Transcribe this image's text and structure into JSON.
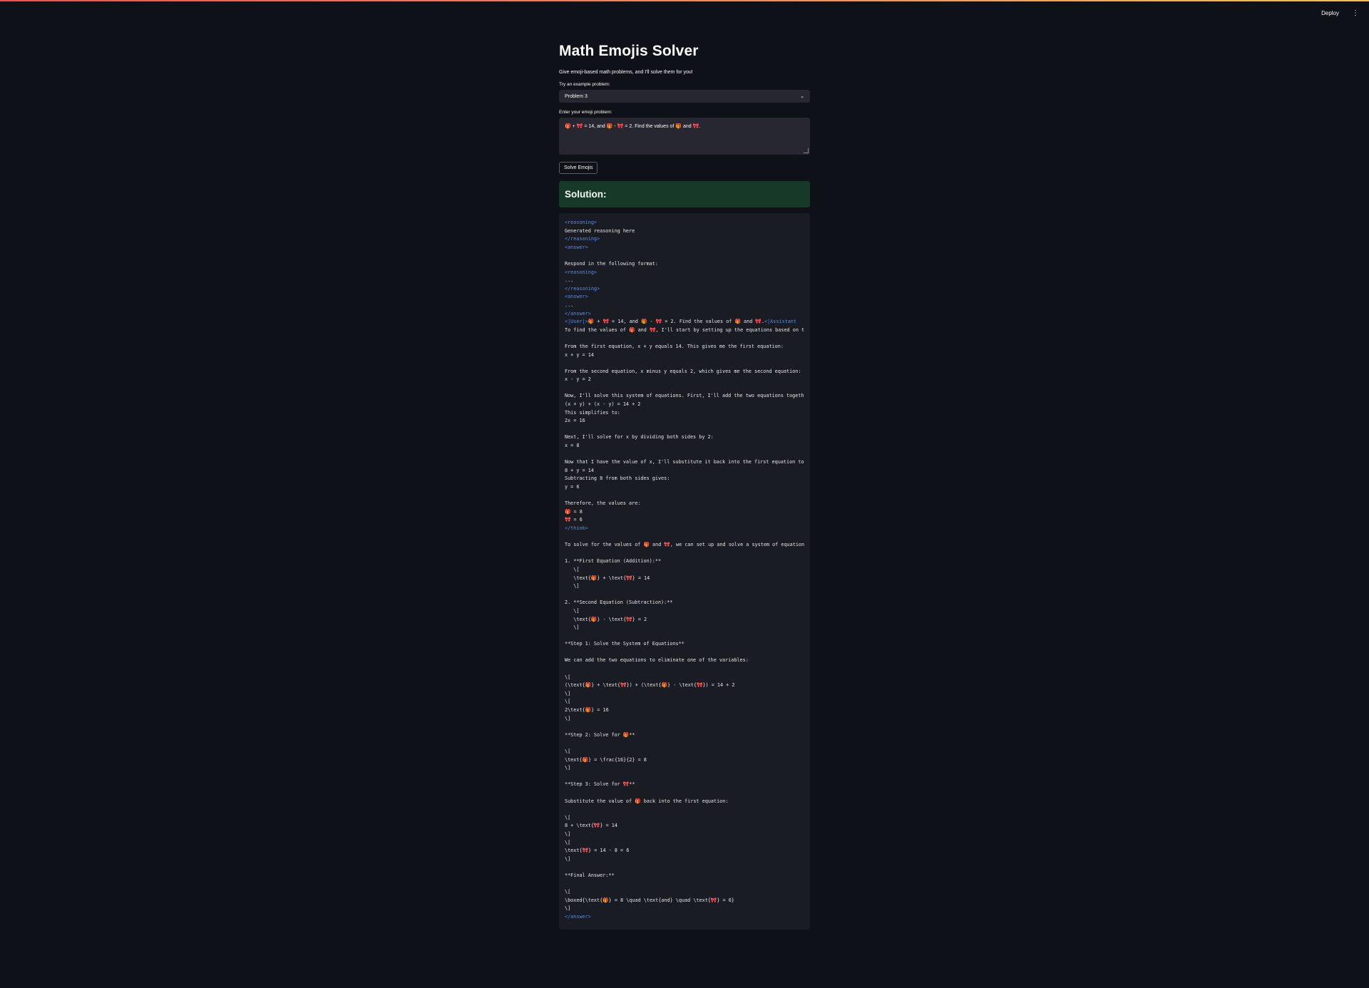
{
  "header": {
    "deploy_label": "Deploy",
    "menu_icon": "vertical-ellipsis-icon"
  },
  "app": {
    "title": "Math Emojis Solver",
    "subtitle": "Give emoji-based math problems, and I'll solve them for you!",
    "example_label": "Try an example problem:",
    "example_selected": "Problem 3",
    "input_label": "Enter your emoji problem:",
    "input_value": "🎁 + 🎀 = 14, and 🎁 - 🎀 = 2. Find the values of 🎁 and 🎀.",
    "solve_button": "Solve Emojis",
    "solution_heading": "Solution:"
  },
  "colors": {
    "background": "#0e1117",
    "widget": "#262730",
    "solution_banner": "#173928",
    "code_background": "#1a1c24",
    "tag_blue": "#4c8dff"
  },
  "solution_lines": [
    {
      "t": "<reasoning>",
      "tag": true
    },
    {
      "t": "Generated reasoning here"
    },
    {
      "t": "</reasoning>",
      "tag": true
    },
    {
      "t": "<answer>",
      "tag": true
    },
    {
      "t": ""
    },
    {
      "t": "Respond in the following format:"
    },
    {
      "t": "<reasoning>",
      "tag": true
    },
    {
      "t": "..."
    },
    {
      "t": "</reasoning>",
      "tag": true
    },
    {
      "t": "<answer>",
      "tag": true
    },
    {
      "t": "..."
    },
    {
      "t": "</answer>",
      "tag": true
    },
    {
      "pre": "<|User|>",
      "t": "🎁 + 🎀 = 14, and 🎁 - 🎀 = 2. Find the values of 🎁 and 🎀.",
      "post": "<|Assistant"
    },
    {
      "t": "To find the values of 🎁 and 🎀, I'll start by setting up the equations based on t"
    },
    {
      "t": ""
    },
    {
      "t": "From the first equation, x + y equals 14. This gives me the first equation:"
    },
    {
      "t": "x + y = 14"
    },
    {
      "t": ""
    },
    {
      "t": "From the second equation, x minus y equals 2, which gives me the second equation:"
    },
    {
      "t": "x - y = 2"
    },
    {
      "t": ""
    },
    {
      "t": "Now, I'll solve this system of equations. First, I'll add the two equations togeth"
    },
    {
      "t": "(x + y) + (x - y) = 14 + 2"
    },
    {
      "t": "This simplifies to:"
    },
    {
      "t": "2x = 16"
    },
    {
      "t": ""
    },
    {
      "t": "Next, I'll solve for x by dividing both sides by 2:"
    },
    {
      "t": "x = 8"
    },
    {
      "t": ""
    },
    {
      "t": "Now that I have the value of x, I'll substitute it back into the first equation to"
    },
    {
      "t": "8 + y = 14"
    },
    {
      "t": "Subtracting 8 from both sides gives:"
    },
    {
      "t": "y = 6"
    },
    {
      "t": ""
    },
    {
      "t": "Therefore, the values are:"
    },
    {
      "t": "🎁 = 8"
    },
    {
      "t": "🎀 = 6"
    },
    {
      "t": "</think>",
      "tag": true
    },
    {
      "t": ""
    },
    {
      "t": "To solve for the values of 🎁 and 🎀, we can set up and solve a system of equation"
    },
    {
      "t": ""
    },
    {
      "t": "1. **First Equation (Addition):**"
    },
    {
      "t": "   \\["
    },
    {
      "t": "   \\text{🎁} + \\text{🎀} = 14"
    },
    {
      "t": "   \\]"
    },
    {
      "t": ""
    },
    {
      "t": "2. **Second Equation (Subtraction):**"
    },
    {
      "t": "   \\["
    },
    {
      "t": "   \\text{🎁} - \\text{🎀} = 2"
    },
    {
      "t": "   \\]"
    },
    {
      "t": ""
    },
    {
      "t": "**Step 1: Solve the System of Equations**"
    },
    {
      "t": ""
    },
    {
      "t": "We can add the two equations to eliminate one of the variables:"
    },
    {
      "t": ""
    },
    {
      "t": "\\["
    },
    {
      "t": "(\\text{🎁} + \\text{🎀}) + (\\text{🎁} - \\text{🎀}) = 14 + 2"
    },
    {
      "t": "\\]"
    },
    {
      "t": "\\["
    },
    {
      "t": "2\\text{🎁} = 16"
    },
    {
      "t": "\\]"
    },
    {
      "t": ""
    },
    {
      "t": "**Step 2: Solve for 🎁**"
    },
    {
      "t": ""
    },
    {
      "t": "\\["
    },
    {
      "t": "\\text{🎁} = \\frac{16}{2} = 8"
    },
    {
      "t": "\\]"
    },
    {
      "t": ""
    },
    {
      "t": "**Step 3: Solve for 🎀**"
    },
    {
      "t": ""
    },
    {
      "t": "Substitute the value of 🎁 back into the first equation:"
    },
    {
      "t": ""
    },
    {
      "t": "\\["
    },
    {
      "t": "8 + \\text{🎀} = 14"
    },
    {
      "t": "\\]"
    },
    {
      "t": "\\["
    },
    {
      "t": "\\text{🎀} = 14 - 8 = 6"
    },
    {
      "t": "\\]"
    },
    {
      "t": ""
    },
    {
      "t": "**Final Answer:**"
    },
    {
      "t": ""
    },
    {
      "t": "\\["
    },
    {
      "t": "\\boxed{\\text{🎁} = 8 \\quad \\text{and} \\quad \\text{🎀} = 6}"
    },
    {
      "t": "\\]"
    },
    {
      "t": "</answer>",
      "tag": true
    }
  ]
}
